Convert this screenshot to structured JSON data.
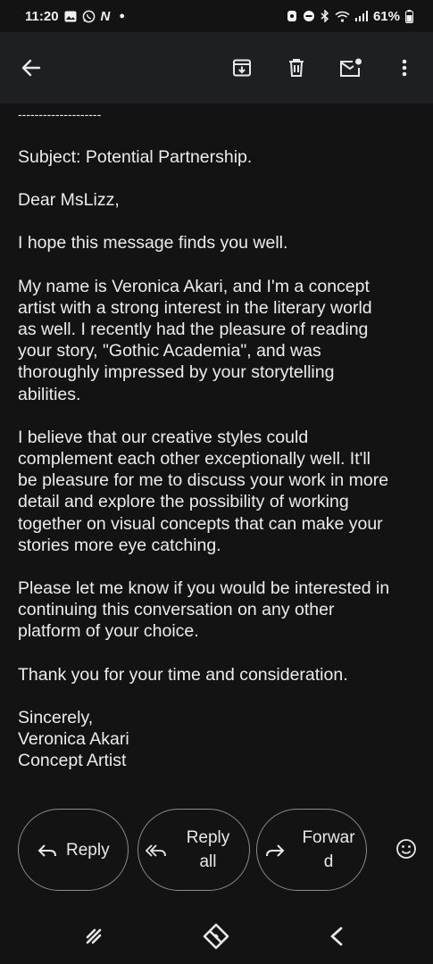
{
  "status_bar": {
    "time": "11:20",
    "battery": "61%",
    "icons": [
      "gallery-icon",
      "whatsapp-icon",
      "n-app-icon",
      "dot-icon",
      "alarm-icon",
      "dnd-icon",
      "bluetooth-icon",
      "wifi-icon",
      "signal-icon",
      "battery-icon"
    ]
  },
  "toolbar": {
    "icons": [
      "back-arrow-icon",
      "archive-icon",
      "delete-icon",
      "mark-unread-icon",
      "more-vert-icon"
    ]
  },
  "email": {
    "divider": "--------------------",
    "subject_line": "Subject: Potential Partnership.",
    "greeting": "Dear MsLizz,",
    "paragraphs": [
      "I hope this message finds you well.",
      "My name is Veronica Akari, and I'm a concept\nartist with a strong interest in the literary world\nas well. I recently had the pleasure of reading\nyour story, \"Gothic Academia\", and was\nthoroughly impressed by your storytelling\nabilities.",
      "I believe that our creative styles could\ncomplement each other exceptionally well. It'll\nbe pleasure for me to discuss your work in more\ndetail and explore the possibility of working\ntogether on visual concepts that can make your\nstories more eye catching.",
      "Please let me know if you would be interested in\ncontinuing this conversation on any other\nplatform of your choice.",
      "Thank you for your time and consideration."
    ],
    "signature": "Sincerely,\nVeronica Akari\nConcept Artist"
  },
  "actions": {
    "reply_label": "Reply",
    "reply_all_label": "Reply\nall",
    "forward_label": "Forwar\nd"
  },
  "navbar": {
    "icons": [
      "recents-icon",
      "home-icon",
      "back-icon"
    ]
  }
}
